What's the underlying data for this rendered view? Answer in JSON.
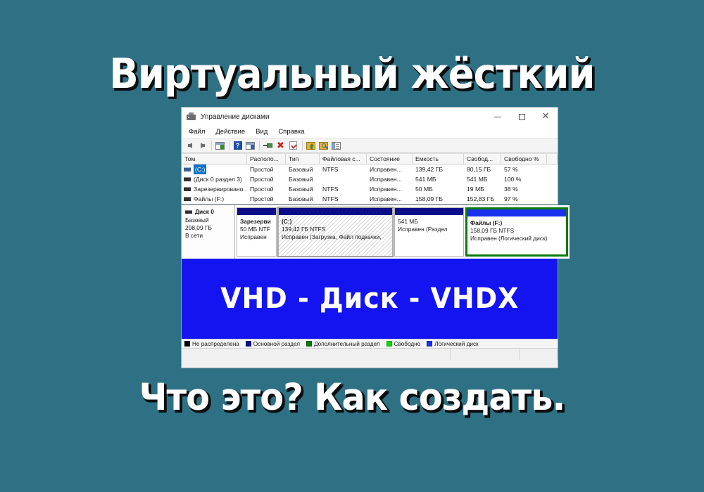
{
  "poster": {
    "title_top": "Виртуальный жёсткий",
    "title_bottom": "Что это? Как создать.",
    "banner_text": "VHD - Диск - VHDX",
    "background_color": "#2f7184",
    "banner_color": "#1414f0",
    "title_color": "#ffffff"
  },
  "window": {
    "title": "Управление дисками",
    "icon": "disk-management-icon",
    "controls": {
      "minimize": "minimize-button",
      "maximize": "maximize-button",
      "close": "close-button"
    },
    "menu": [
      "Файл",
      "Действие",
      "Вид",
      "Справка"
    ],
    "toolbar": [
      "back-arrow-icon",
      "forward-arrow-icon",
      "separator",
      "show-hide-console-tree-icon",
      "separator",
      "help-icon",
      "show-hide-action-pane-icon",
      "separator",
      "properties-icon",
      "delete-icon",
      "rescan-disks-icon",
      "separator",
      "open-icon",
      "explore-icon",
      "list-view-icon"
    ]
  },
  "volume_table": {
    "columns": [
      "Том",
      "Располо...",
      "Тип",
      "Файловая с...",
      "Состояние",
      "Емкость",
      "Свобод...",
      "Свободно %",
      ""
    ],
    "rows": [
      {
        "name": "(C:)",
        "selected": true,
        "icon": "volume-icon-blue",
        "layout": "Простой",
        "type": "Базовый",
        "filesystem": "NTFS",
        "status": "Исправен...",
        "capacity": "139,42 ГБ",
        "free": "80,15 ГБ",
        "free_pct": "57 %"
      },
      {
        "name": "(Диск 0 раздел 3)",
        "selected": false,
        "icon": "volume-icon-dark",
        "layout": "Простой",
        "type": "Базовый",
        "filesystem": "",
        "status": "Исправен...",
        "capacity": "541 МБ",
        "free": "541 МБ",
        "free_pct": "100 %"
      },
      {
        "name": "Зарезервировано...",
        "selected": false,
        "icon": "volume-icon-dark",
        "layout": "Простой",
        "type": "Базовый",
        "filesystem": "NTFS",
        "status": "Исправен...",
        "capacity": "50 МБ",
        "free": "19 МБ",
        "free_pct": "38 %"
      },
      {
        "name": "Файлы (F:)",
        "selected": false,
        "icon": "volume-icon-dark",
        "layout": "Простой",
        "type": "Базовый",
        "filesystem": "NTFS",
        "status": "Исправен...",
        "capacity": "158,09 ГБ",
        "free": "152,83 ГБ",
        "free_pct": "97 %"
      }
    ]
  },
  "disk_view": {
    "disk": {
      "name": "Диск 0",
      "type": "Базовый",
      "size": "298,09 ГБ",
      "state": "В сети"
    },
    "partitions": [
      {
        "label": "Зарезерви",
        "size": "50 МБ NTF",
        "status": "Исправен",
        "header_color": "#0d0d8a",
        "kind": "primary"
      },
      {
        "label": "(C:)",
        "size": "139,42 ГБ NTFS",
        "status": "Исправен (Загрузка, Файл подкачки, ",
        "header_color": "#0d0d8a",
        "kind": "primary-selected"
      },
      {
        "label": "",
        "size": "541 МБ",
        "status": "Исправен (Раздел",
        "header_color": "#0d0d8a",
        "kind": "primary"
      },
      {
        "label": "Файлы  (F:)",
        "size": "158,09 ГБ NTFS",
        "status": "Исправен (Логический диск)",
        "header_color": "#1a30ee",
        "kind": "logical"
      }
    ]
  },
  "legend": [
    {
      "label": "Не распределена",
      "color": "#000000"
    },
    {
      "label": "Основной раздел",
      "color": "#0d0d8a"
    },
    {
      "label": "Дополнительный раздел",
      "color": "#0a7a0a"
    },
    {
      "label": "Свободно",
      "color": "#00e000"
    },
    {
      "label": "Логический диск",
      "color": "#1a30ee"
    }
  ]
}
